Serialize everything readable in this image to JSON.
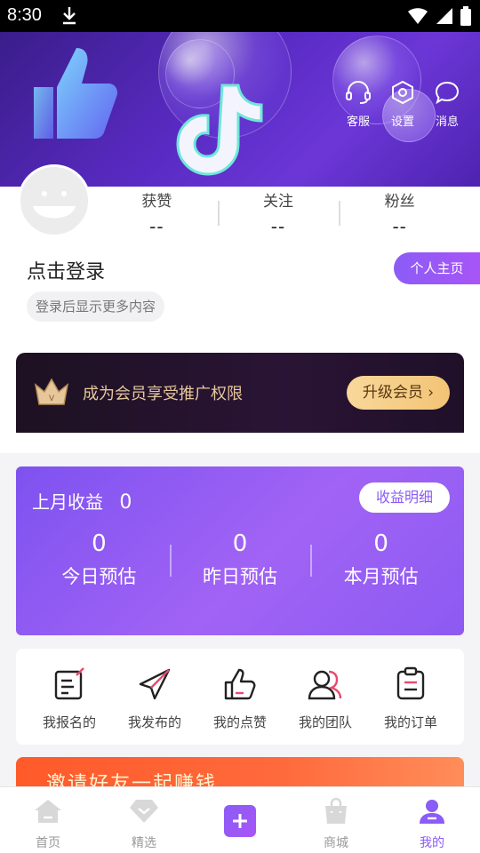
{
  "status_bar": {
    "time": "8:30",
    "icons": [
      "download-icon",
      "wifi-icon",
      "signal-icon",
      "battery-icon"
    ]
  },
  "header": {
    "actions": [
      {
        "label": "客服",
        "icon": "headset-icon"
      },
      {
        "label": "设置",
        "icon": "settings-icon"
      },
      {
        "label": "消息",
        "icon": "message-icon"
      }
    ]
  },
  "profile": {
    "stats": [
      {
        "label": "获赞",
        "value": "--"
      },
      {
        "label": "关注",
        "value": "--"
      },
      {
        "label": "粉丝",
        "value": "--"
      }
    ],
    "login_title": "点击登录",
    "login_hint": "登录后显示更多内容",
    "home_button": "个人主页"
  },
  "vip": {
    "text": "成为会员享受推广权限",
    "button": "升级会员",
    "icon": "crown-icon",
    "accent": "#e6c79b"
  },
  "earnings": {
    "title": "上月收益",
    "last_month": "0",
    "detail_button": "收益明细",
    "items": [
      {
        "value": "0",
        "label": "今日预估"
      },
      {
        "value": "0",
        "label": "昨日预估"
      },
      {
        "value": "0",
        "label": "本月预估"
      }
    ]
  },
  "menu": [
    {
      "label": "我报名的",
      "icon": "signup-icon"
    },
    {
      "label": "我发布的",
      "icon": "paper-plane-icon"
    },
    {
      "label": "我的点赞",
      "icon": "thumbs-up-icon"
    },
    {
      "label": "我的团队",
      "icon": "team-icon"
    },
    {
      "label": "我的订单",
      "icon": "clipboard-icon"
    }
  ],
  "invite_banner": {
    "text": "邀请好友一起赚钱"
  },
  "tab_bar": {
    "accent": "#8b5cf6",
    "tabs": [
      {
        "label": "首页",
        "icon": "home-icon"
      },
      {
        "label": "精选",
        "icon": "diamond-icon"
      },
      {
        "label": "",
        "icon": "plus-icon"
      },
      {
        "label": "商城",
        "icon": "shopping-bag-icon"
      },
      {
        "label": "我的",
        "icon": "user-icon",
        "active": true
      }
    ]
  }
}
